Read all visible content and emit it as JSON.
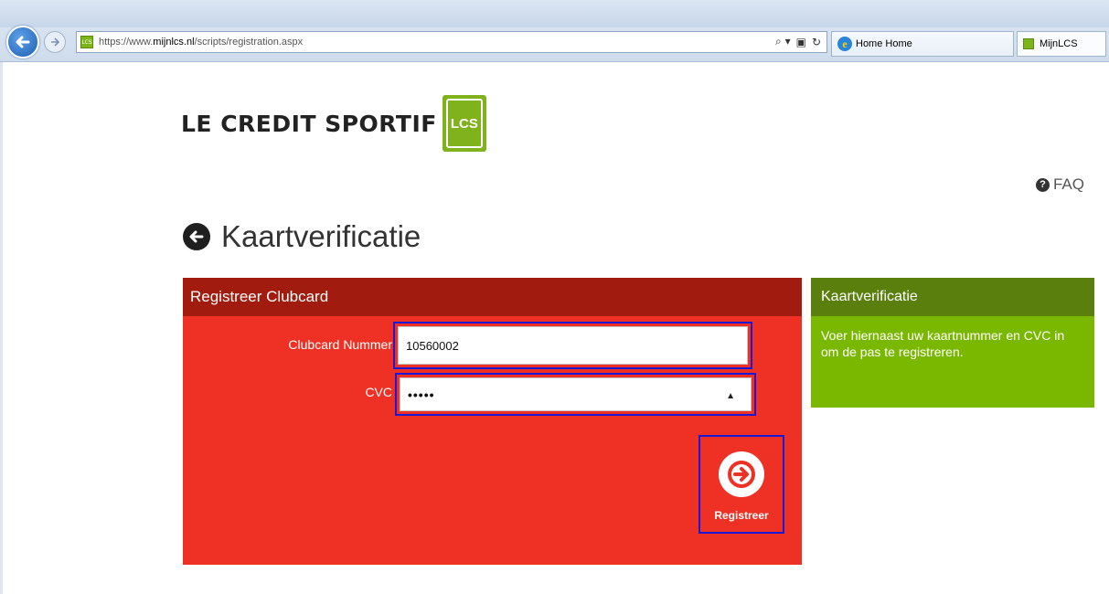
{
  "browser": {
    "url_prefix": "https://www.",
    "url_host": "mijnlcs.nl",
    "url_path": "/scripts/registration.aspx",
    "favicon_text": "LCS",
    "tabs": [
      {
        "label": "Home Home"
      },
      {
        "label": "MijnLCS"
      }
    ],
    "tools": {
      "search": "⌕ ▾",
      "lock": "🔒",
      "refresh": "↻"
    }
  },
  "logo": {
    "text": "LE CREDIT SPORTIF",
    "box_text": "LCS",
    "brand_color": "#80b21b"
  },
  "faq": {
    "label": "FAQ"
  },
  "page": {
    "title": "Kaartverificatie"
  },
  "form": {
    "header": "Registreer Clubcard",
    "clubcard_label": "Clubcard Nummer",
    "clubcard_value": "10560002",
    "cvc_label": "CVC",
    "cvc_value": "•••••",
    "submit_label": "Registreer",
    "panel_color": "#ee3124",
    "header_color": "#a11c0f"
  },
  "info": {
    "header": "Kaartverificatie",
    "body": "Voer hiernaast uw kaartnummer en CVC in om de pas te registreren.",
    "panel_color": "#7ab800"
  }
}
